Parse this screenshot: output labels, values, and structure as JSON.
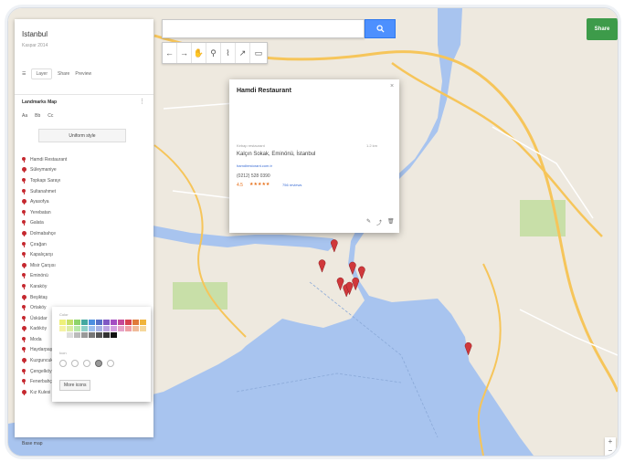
{
  "map": {
    "title": "Istanbul",
    "subtitle": "Kaspar 2014",
    "base_map_label": "Base map"
  },
  "toolbar": {
    "share_label": "Share",
    "search_icon": "search-icon",
    "tools": [
      "undo-icon",
      "redo-icon",
      "hand-icon",
      "marker-icon",
      "line-icon",
      "route-icon",
      "ruler-icon"
    ]
  },
  "panel": {
    "actions": [
      "Layer",
      "Share",
      "Preview"
    ],
    "layer_title": "Landmarks Map",
    "layer_tabs": [
      "Aa",
      "Bb",
      "Cc"
    ],
    "style_button": "Uniform style",
    "places": [
      "Hamdi Restaurant",
      "Süleymaniye",
      "Topkapı Sarayı",
      "Sultanahmet",
      "Ayasofya",
      "Yerebatan",
      "Galata",
      "Dolmabahçe",
      "Çırağan",
      "Kapalıçarşı",
      "Misir Çarşısı",
      "Eminönü",
      "Karaköy",
      "Beşiktaş",
      "Ortaköy",
      "Üsküdar",
      "Kadıköy",
      "Moda",
      "Haydarpaşa",
      "Kuzguncuk",
      "Çengelköy",
      "Fenerbahçe",
      "Kız Kulesi"
    ]
  },
  "popup": {
    "color_label": "Color",
    "icon_label": "Icon",
    "more_icons_label": "More icons",
    "colors": [
      "#eef07a",
      "#c7e06a",
      "#8fd46b",
      "#44a8a0",
      "#4d8fe0",
      "#5770c8",
      "#7f58c4",
      "#a44dc2",
      "#c44a9a",
      "#d84350",
      "#e07a3a",
      "#f0b43c",
      "#f5f2a5",
      "#dceca3",
      "#b8e8a8",
      "#8ed0c8",
      "#9dbfee",
      "#a7b2e4",
      "#bca4e2",
      "#d39ee0",
      "#e5a2c9",
      "#eea0a6",
      "#f0bb9a",
      "#f6d89c",
      "#ffffff",
      "#dddddd",
      "#bbbbbb",
      "#999999",
      "#777777",
      "#555555",
      "#333333",
      "#111111"
    ]
  },
  "info": {
    "title": "Hamdi Restaurant",
    "category": "Kebap restaurant",
    "distance": "1.2 km",
    "address": "Kalçın Sokak, Eminönü, İstanbul",
    "website_link": "hamdirestorant.com.tr",
    "phone": "(0212) 528 0390",
    "rating_value": "4.5",
    "stars": "★★★★★",
    "reviews_label": "756 reviews"
  },
  "zoom": {
    "plus": "+",
    "minus": "−"
  },
  "markers": [
    {
      "kind": "red",
      "lon": 0.565,
      "lat": 0.595
    },
    {
      "kind": "red",
      "lon": 0.515,
      "lat": 0.59
    },
    {
      "kind": "red",
      "lon": 0.545,
      "lat": 0.63
    },
    {
      "kind": "red",
      "lon": 0.555,
      "lat": 0.645
    },
    {
      "kind": "red",
      "lon": 0.56,
      "lat": 0.64
    },
    {
      "kind": "red",
      "lon": 0.57,
      "lat": 0.63
    },
    {
      "kind": "red",
      "lon": 0.58,
      "lat": 0.605
    },
    {
      "kind": "red",
      "lon": 0.535,
      "lat": 0.545
    },
    {
      "kind": "red",
      "lon": 0.755,
      "lat": 0.775
    }
  ]
}
